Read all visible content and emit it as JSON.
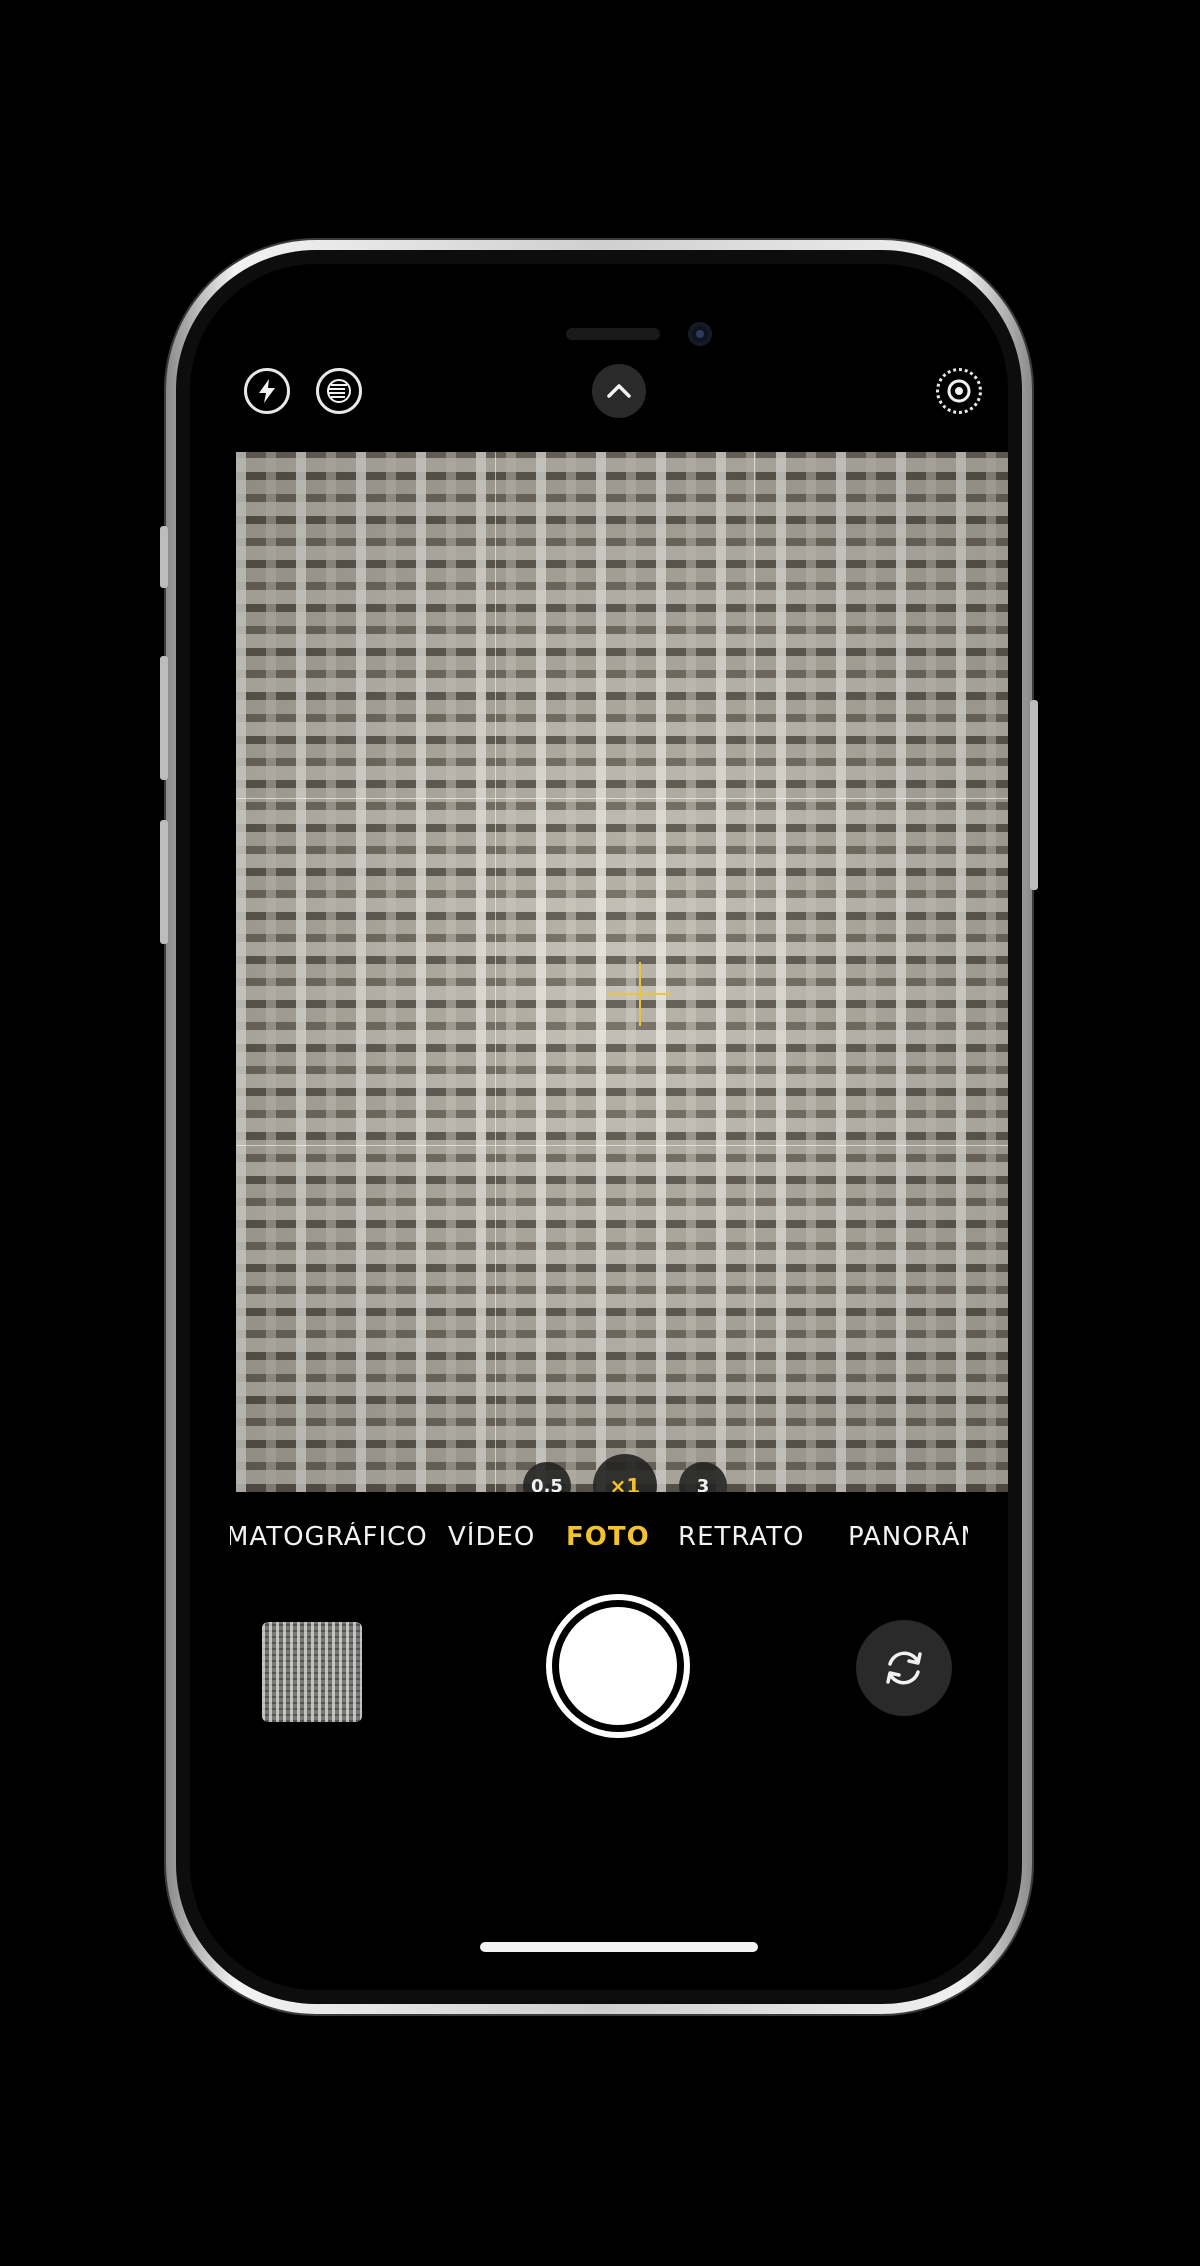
{
  "topbar": {
    "flash_icon": "flash-icon",
    "live_photo_icon": "live-photo-icon",
    "chevron_icon": "chevron-up-icon",
    "live_icon": "live-target-icon"
  },
  "viewfinder": {
    "focus_color": "#e8c440"
  },
  "zoom": {
    "options": [
      "0,5",
      "×1",
      "3"
    ],
    "active_index": 1
  },
  "modes": {
    "items": [
      "MATOGRÁFICO",
      "VÍDEO",
      "FOTO",
      "RETRATO",
      "PANORÁMIC"
    ],
    "active": "FOTO",
    "accent_color": "#f2c230"
  },
  "controls": {
    "thumbnail_icon": "last-photo-thumbnail",
    "shutter_icon": "shutter-button",
    "flip_icon": "camera-flip-icon"
  }
}
